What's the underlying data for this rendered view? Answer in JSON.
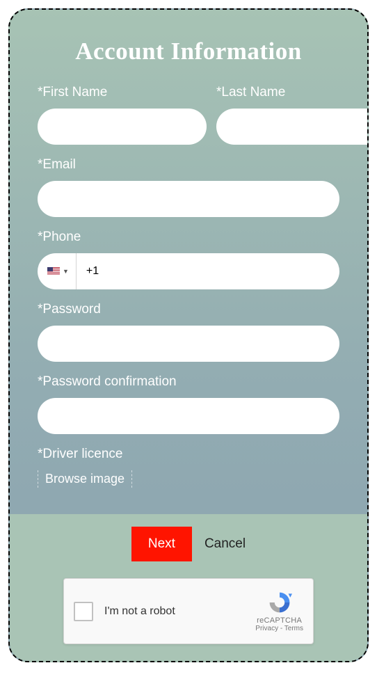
{
  "title": "Account Information",
  "fields": {
    "first_name": {
      "label": "*First Name",
      "value": ""
    },
    "last_name": {
      "label": "*Last Name",
      "value": ""
    },
    "email": {
      "label": "*Email",
      "value": ""
    },
    "phone": {
      "label": "*Phone",
      "value": "+1",
      "country": "US"
    },
    "password": {
      "label": "*Password",
      "value": ""
    },
    "password_confirm": {
      "label": "*Password confirmation",
      "value": ""
    },
    "driver_licence": {
      "label": "*Driver licence",
      "browse_label": "Browse image"
    }
  },
  "buttons": {
    "next": "Next",
    "cancel": "Cancel"
  },
  "captcha": {
    "label": "I'm not a robot",
    "brand": "reCAPTCHA",
    "links": "Privacy - Terms"
  }
}
